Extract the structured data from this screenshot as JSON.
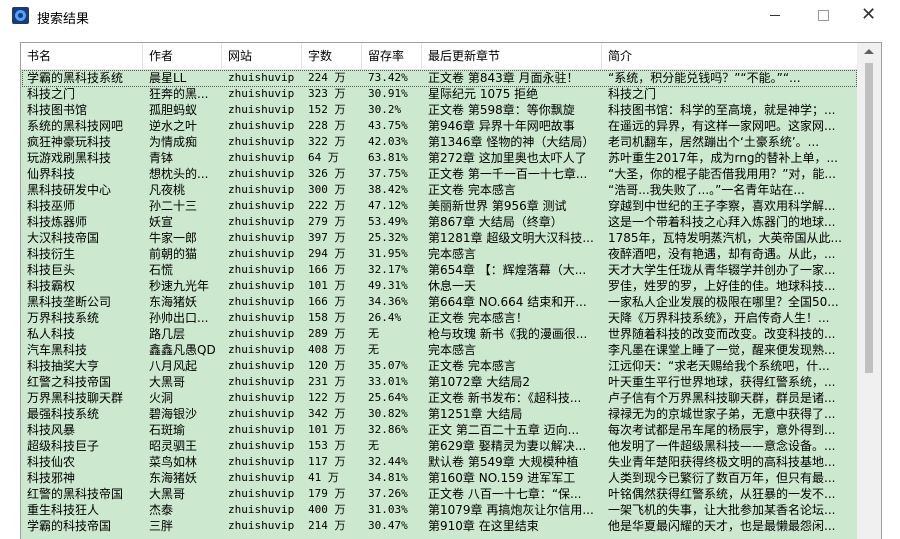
{
  "window": {
    "title": "搜索结果"
  },
  "columns": [
    "书名",
    "作者",
    "网站",
    "字数",
    "留存率",
    "最后更新章节",
    "简介"
  ],
  "rows": [
    [
      "学霸的黑科技系统",
      "晨星LL",
      "zhuishuvip",
      "224 万",
      "73.42%",
      "正文卷 第843章 月面永驻！",
      "“系统，积分能兑钱吗？”“不能。”“..."
    ],
    [
      "科技之门",
      "狂奔的黑...",
      "zhuishuvip",
      "323 万",
      "30.91%",
      "星际纪元 1075 拒绝",
      "科技之门"
    ],
    [
      "科技图书馆",
      "孤胆蚂蚁",
      "zhuishuvip",
      "152 万",
      "30.2%",
      "正文卷 第598章：等你飘旋",
      "科技图书馆：科学的至高境，就是神学；..."
    ],
    [
      "系统的黑科技网吧",
      "逆水之叶",
      "zhuishuvip",
      "228 万",
      "43.75%",
      "第946章 异界十年网吧故事",
      "在遥远的异界，有这样一家网吧。这家网..."
    ],
    [
      "疯狂神豪玩科技",
      "为情成痴",
      "zhuishuvip",
      "322 万",
      "42.03%",
      "第1346章 怪物的神（大结局）",
      "老司机翻车，居然蹦出个‘土豪系统’。..."
    ],
    [
      "玩游戏刷黑科技",
      "青钵",
      "zhuishuvip",
      "64 万",
      "63.81%",
      "第272章 这加里奥也太吓人了",
      "苏叶重生2017年，成为rng的替补上单，..."
    ],
    [
      "仙界科技",
      "想枕头的...",
      "zhuishuvip",
      "326 万",
      "37.75%",
      "正文卷 第一千一百一十七章...",
      "“大圣，你的棍子能否借我用用？”对，能..."
    ],
    [
      "黑科技研发中心",
      "凡夜桃",
      "zhuishuvip",
      "300 万",
      "38.42%",
      "正文卷 完本感言",
      "“浩哥...我失败了...。”一名青年站在..."
    ],
    [
      "科技巫师",
      "孙二十三",
      "zhuishuvip",
      "222 万",
      "47.12%",
      "美丽新世界 第956章 测试",
      "穿越到中世纪的王子李察，喜欢用科学解..."
    ],
    [
      "科技炼器师",
      "妖宣",
      "zhuishuvip",
      "279 万",
      "53.49%",
      "第867章 大结局（终章）",
      "这是一个带着科技之心拜入炼器门的地球..."
    ],
    [
      "大汉科技帝国",
      "牛家一郎",
      "zhuishuvip",
      "397 万",
      "25.32%",
      "第1281章 超级文明大汉科技...",
      "1785年，瓦特发明蒸汽机，大英帝国从此..."
    ],
    [
      "科技衍生",
      "前朝的猫",
      "zhuishuvip",
      "294 万",
      "31.95%",
      "完本感言",
      "夜醉酒吧，没有艳遇，却有奇遇。从此，..."
    ],
    [
      "科技巨头",
      "石慌",
      "zhuishuvip",
      "166 万",
      "32.17%",
      "第654章 【：辉煌落幕（大...",
      "天才大学生任珑从青华辍学并创办了一家..."
    ],
    [
      "科技霸权",
      "秒速九光年",
      "zhuishuvip",
      "101 万",
      "49.31%",
      "休息一天",
      "罗佳，姓罗的罗，上好佳的佳。地球科技..."
    ],
    [
      "黑科技垄断公司",
      "东海猪妖",
      "zhuishuvip",
      "166 万",
      "34.36%",
      "第664章 NO.664 结束和开...",
      "一家私人企业发展的极限在哪里？全国50..."
    ],
    [
      "万界科技系统",
      "孙帅出口...",
      "zhuishuvip",
      "158 万",
      "26.4%",
      "正文卷 完本感言！",
      "天降《万界科技系统》，开启传奇人生！..."
    ],
    [
      "私人科技",
      "路几层",
      "zhuishuvip",
      "289 万",
      "无",
      "枪与玫瑰 新书《我的漫画很...",
      "世界随着科技的改变而改变。改变科技的..."
    ],
    [
      "汽车黑科技",
      "鑫鑫凡愚QD",
      "zhuishuvip",
      "408 万",
      "无",
      "完本感言",
      "李凡墨在课堂上睡了一觉，醒来便发现熟..."
    ],
    [
      "科技抽奖大亨",
      "八月风起",
      "zhuishuvip",
      "120 万",
      "35.07%",
      "正文卷 完本感言",
      "江远仰天：“求老天赐给我个系统吧，什..."
    ],
    [
      "红警之科技帝国",
      "大黑哥",
      "zhuishuvip",
      "231 万",
      "33.01%",
      "第1072章 大结局2",
      "叶天重生平行世界地球，获得红警系统，..."
    ],
    [
      "万界黑科技聊天群",
      "火洞",
      "zhuishuvip",
      "122 万",
      "25.64%",
      "正文卷 新书发布：《超科技...",
      "卢子信有个万界黑科技聊天群，群员是诸..."
    ],
    [
      "最强科技系统",
      "碧海银沙",
      "zhuishuvip",
      "342 万",
      "30.82%",
      "第1251章 大结局",
      "禄禄无为的京城世家子弟，无意中获得了..."
    ],
    [
      "科技风暴",
      "石斑瑜",
      "zhuishuvip",
      "101 万",
      "32.86%",
      "正文 第二百二十五章 迈向...",
      "每次考试都是吊车尾的杨辰宇，意外得到..."
    ],
    [
      "超级科技巨子",
      "昭灵驷王",
      "zhuishuvip",
      "153 万",
      "无",
      "第629章 娶精灵为妻以解决...",
      "他发明了一件超级黑科技——意念设备。..."
    ],
    [
      "科技仙农",
      "菜鸟如林",
      "zhuishuvip",
      "117 万",
      "32.44%",
      "默认卷 第549章 大规模种植",
      "失业青年楚阳获得终极文明的高科技基地..."
    ],
    [
      "科技邪神",
      "东海猪妖",
      "zhuishuvip",
      "41 万",
      "34.81%",
      "第160章 NO.159 进军军工",
      "人类到现今已繁衍了数百万年，但只有最..."
    ],
    [
      "红警的黑科技帝国",
      "大黑哥",
      "zhuishuvip",
      "179 万",
      "37.26%",
      "正文卷 八百一十七章：“保...",
      "叶铭偶然获得红警系统，从狂暴的一发不..."
    ],
    [
      "重生科技狂人",
      "杰泰",
      "zhuishuvip",
      "400 万",
      "31.03%",
      "第1079章 再搞炮灰让尔信用...",
      "一架飞机的失事，让大批参加某香名论坛..."
    ],
    [
      "学霸的科技帝国",
      "三胖",
      "zhuishuvip",
      "214 万",
      "30.47%",
      "第910章 在这里结束",
      "他是华夏最闪耀的天才，也是最懒最怨闲..."
    ]
  ]
}
